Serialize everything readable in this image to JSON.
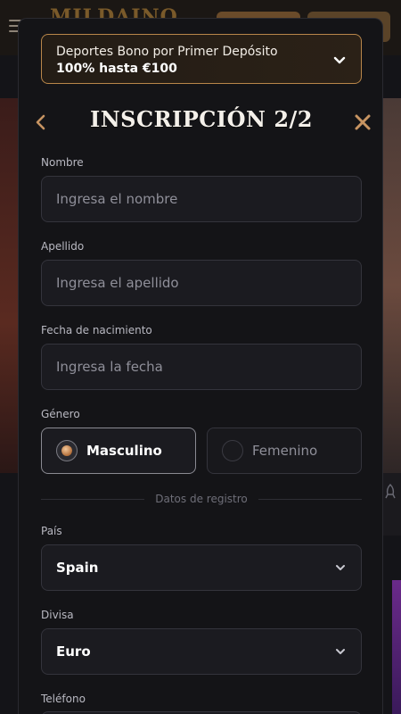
{
  "background": {
    "logo_text": "MILDAINO"
  },
  "bonus": {
    "title": "Deportes Bono por Primer Depósito",
    "subtitle": "100% hasta €100",
    "icon": "chevron-down-icon"
  },
  "header": {
    "title": "INSCRIPCIÓN 2/2",
    "back_icon": "chevron-left-icon",
    "close_icon": "close-icon",
    "accent_color": "#c79462"
  },
  "form": {
    "nombre": {
      "label": "Nombre",
      "placeholder": "Ingresa el nombre"
    },
    "apellido": {
      "label": "Apellido",
      "placeholder": "Ingresa el apellido"
    },
    "fecha": {
      "label": "Fecha de nacimiento",
      "placeholder": "Ingresa la fecha"
    },
    "genero": {
      "label": "Género",
      "options": [
        {
          "label": "Masculino",
          "selected": true
        },
        {
          "label": "Femenino",
          "selected": false
        }
      ]
    },
    "divider_text": "Datos de registro",
    "pais": {
      "label": "País",
      "value": "Spain"
    },
    "divisa": {
      "label": "Divisa",
      "value": "Euro"
    },
    "telefono": {
      "label": "Teléfono"
    }
  }
}
